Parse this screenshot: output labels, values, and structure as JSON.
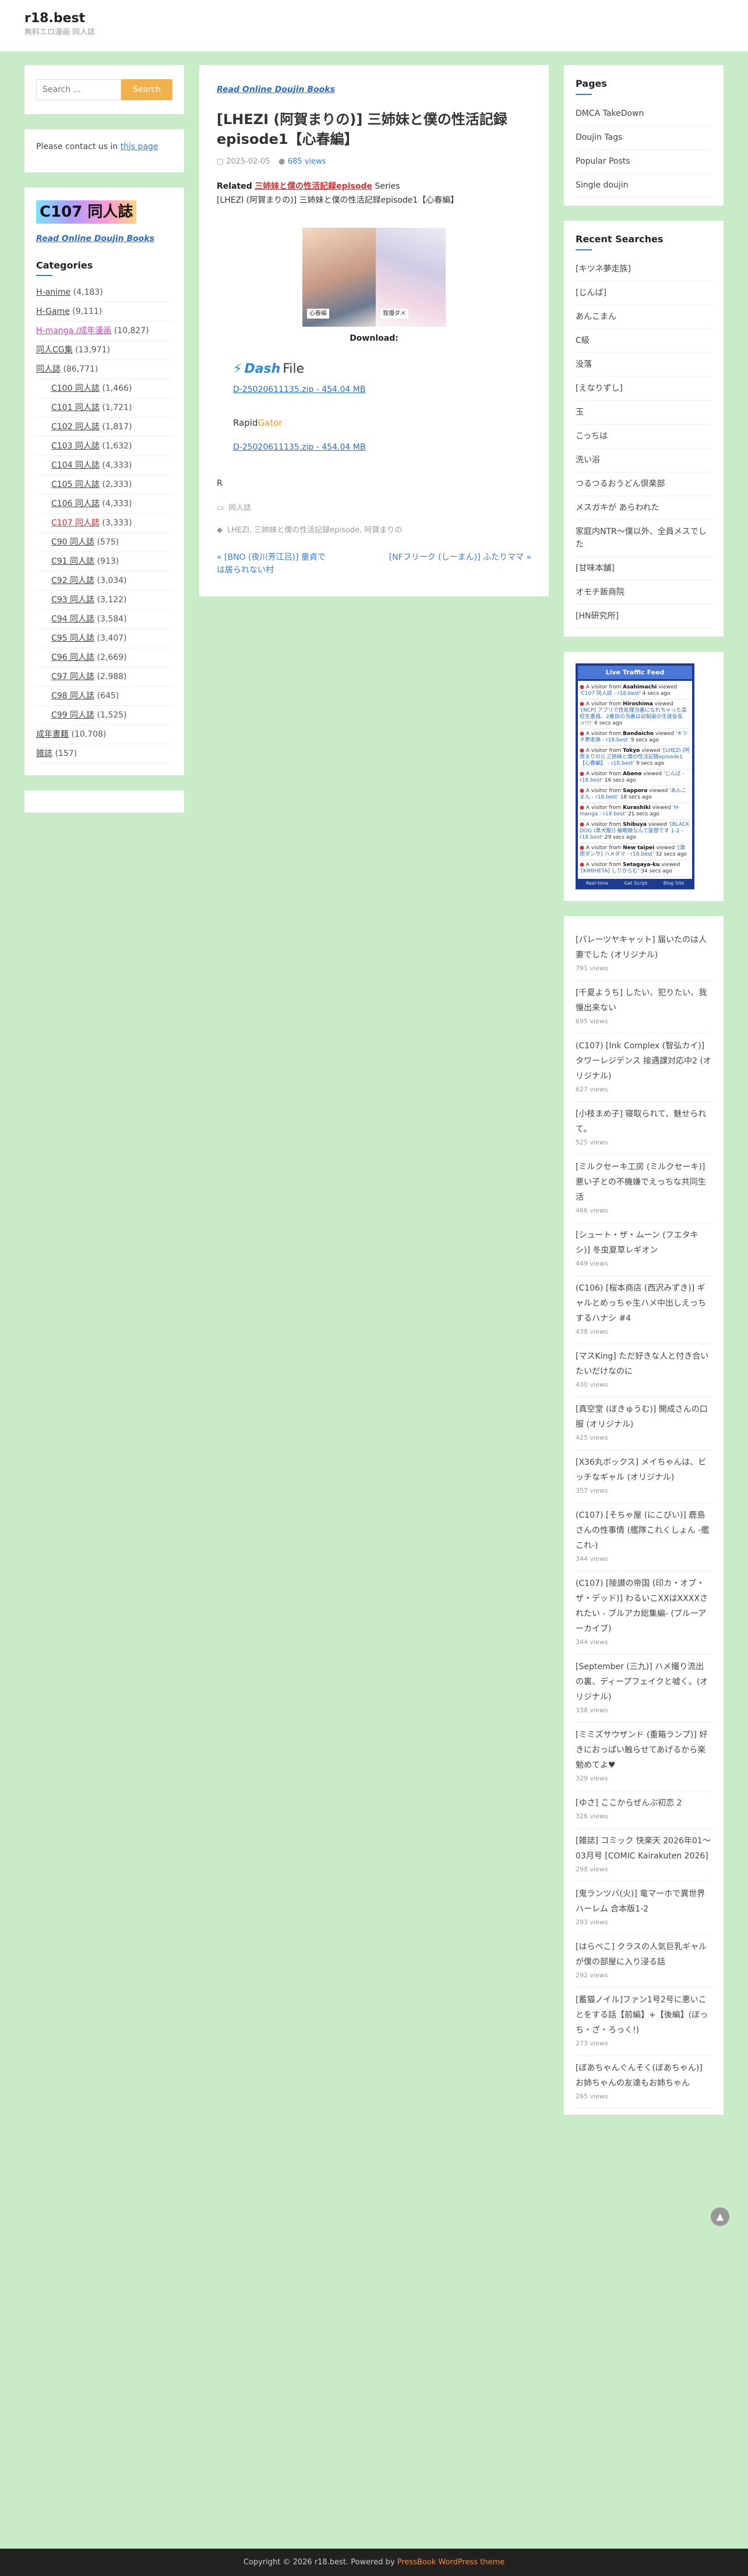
{
  "site": {
    "title": "r18.best",
    "description": "無料エロ漫画 同人誌"
  },
  "search": {
    "placeholder": "Search ...",
    "button": "Search"
  },
  "contact": {
    "prefix": "Please contact us in ",
    "link": "this page"
  },
  "left": {
    "logo_text": "C107 同人誌",
    "read_online": "Read Online Doujin Books",
    "categories_title": "Categories",
    "categories": [
      {
        "label": "H-anime",
        "count": "(4,183)",
        "sub": false,
        "style": ""
      },
      {
        "label": "H-Game",
        "count": "(9,111)",
        "sub": false,
        "style": ""
      },
      {
        "label": "H-manga /成年漫画",
        "count": "(10,827)",
        "sub": false,
        "style": "pink"
      },
      {
        "label": "同人CG集",
        "count": "(13,971)",
        "sub": false,
        "style": ""
      },
      {
        "label": "同人誌",
        "count": "(86,771)",
        "sub": false,
        "style": ""
      },
      {
        "label": "C100 同人誌",
        "count": "(1,466)",
        "sub": true,
        "style": ""
      },
      {
        "label": "C101 同人誌",
        "count": "(1,721)",
        "sub": true,
        "style": ""
      },
      {
        "label": "C102 同人誌",
        "count": "(1,817)",
        "sub": true,
        "style": ""
      },
      {
        "label": "C103 同人誌",
        "count": "(1,632)",
        "sub": true,
        "style": ""
      },
      {
        "label": "C104 同人誌",
        "count": "(4,333)",
        "sub": true,
        "style": ""
      },
      {
        "label": "C105 同人誌",
        "count": "(2,333)",
        "sub": true,
        "style": ""
      },
      {
        "label": "C106 同人誌",
        "count": "(4,333)",
        "sub": true,
        "style": ""
      },
      {
        "label": "C107 同人誌",
        "count": "(3,333)",
        "sub": true,
        "style": "red"
      },
      {
        "label": "C90 同人誌",
        "count": "(575)",
        "sub": true,
        "style": ""
      },
      {
        "label": "C91 同人誌",
        "count": "(913)",
        "sub": true,
        "style": ""
      },
      {
        "label": "C92 同人誌",
        "count": "(3,034)",
        "sub": true,
        "style": ""
      },
      {
        "label": "C93 同人誌",
        "count": "(3,122)",
        "sub": true,
        "style": ""
      },
      {
        "label": "C94 同人誌",
        "count": "(3,584)",
        "sub": true,
        "style": ""
      },
      {
        "label": "C95 同人誌",
        "count": "(3,407)",
        "sub": true,
        "style": ""
      },
      {
        "label": "C96 同人誌",
        "count": "(2,669)",
        "sub": true,
        "style": ""
      },
      {
        "label": "C97 同人誌",
        "count": "(2,988)",
        "sub": true,
        "style": ""
      },
      {
        "label": "C98 同人誌",
        "count": "(645)",
        "sub": true,
        "style": ""
      },
      {
        "label": "C99 同人誌",
        "count": "(1,525)",
        "sub": true,
        "style": ""
      },
      {
        "label": "成年書籍",
        "count": "(10,708)",
        "sub": false,
        "style": ""
      },
      {
        "label": "雑誌",
        "count": "(157)",
        "sub": false,
        "style": ""
      }
    ]
  },
  "post": {
    "top_link": "Read Online Doujin Books",
    "title": "[LHEZI (阿賀まりの)] 三姉妹と僕の性活記録episode1【心春編】",
    "date": "2025-02-05",
    "views": "685 views",
    "related_prefix": "Related",
    "related_series": "三姉妹と僕の性活記録episode",
    "related_suffix": "Series",
    "related_item": "[LHEZI (阿賀まりの)] 三姉妹と僕の性活記録episode1【心春編】",
    "cover_tag_left": "心春編",
    "cover_tag_right": "我慢ダメ",
    "download_label": "Download:",
    "dash_prefix": "Dash",
    "dash_suffix": "File",
    "dash_link": "D-25020611135.zip - 454.04 MB",
    "rapid_prefix": "Rapid",
    "rapid_suffix": "Gator",
    "rapid_link": "D-25020611135.zip - 454.04 MB",
    "letter": "R",
    "category": "同人誌",
    "tags": "LHEZI, 三姉妹と僕の性活記録episode, 阿賀まりの",
    "prev": "« [BNO (夜川芳江吕)] 童貞では居られない村",
    "next": "[NFフリーク (しーまん)] ふたりママ »"
  },
  "pages": {
    "title": "Pages",
    "items": [
      "DMCA TakeDown",
      "Doujin Tags",
      "Popular Posts",
      "Single doujin"
    ]
  },
  "recent": {
    "title": "Recent Searches",
    "items": [
      "[キツネ夢走族]",
      "[じんば]",
      "あんこまん",
      "C級",
      "没落",
      "[えなりずし]",
      "玉",
      "こっちは",
      "洗い浴",
      "つるつるおうどん倶楽部",
      "メスガキが あらわれた",
      "家庭内NTR〜僕以外、全員メスでした",
      "[甘味本舗]",
      "オモチ飯商院",
      "[HN研究所]"
    ]
  },
  "feed": {
    "title": "Live Traffic Feed",
    "items": [
      {
        "loc": "Asahimachi",
        "viewed": "'C107 同人誌 - r18.best'",
        "ago": "4 secs ago"
      },
      {
        "loc": "Hiroshima",
        "viewed": "'[NCP] アブリで性処理当番になれちゃった高校生委員。2番目の当番は幼馴染の生徒会長ッ!!!' ",
        "ago": "6 secs ago"
      },
      {
        "loc": "Bandaicho",
        "viewed": "'キツネ夢走族 - r18.best'",
        "ago": "9 secs ago"
      },
      {
        "loc": "Tokyo",
        "viewed": "'[LHEZI (阿賀まりの)] 三姉妹と僕の性活記録episode1【心春編】 - r18.best'",
        "ago": "9 secs ago"
      },
      {
        "loc": "Abeno",
        "viewed": "'じんば - r18.best'",
        "ago": "16 secs ago"
      },
      {
        "loc": "Sapporo",
        "viewed": "'あんこまん - r18.best'",
        "ago": "18 secs ago"
      },
      {
        "loc": "Kurashiki",
        "viewed": "'H-manga - r18.best'",
        "ago": "21 secs ago"
      },
      {
        "loc": "Shibuya",
        "viewed": "'[BLACK DOG (黒犬獣)] 催眠娘なんて妄想です 1-2 - r18.best'",
        "ago": "29 secs ago"
      },
      {
        "loc": "New taipei",
        "viewed": "'[激昂ダンサ] ハメダマ - r18.best'",
        "ago": "32 secs ago"
      },
      {
        "loc": "Setagaya-ku",
        "viewed": "'[KIMIHETA] しりからむ'",
        "ago": "34 secs ago"
      }
    ],
    "visitor_prefix": "A visitor from",
    "viewed_word": "viewed",
    "footer": [
      "Real-time",
      "Get Script",
      "Blog Site"
    ]
  },
  "popular": [
    {
      "title": "[パレーツヤキャット] 届いたのは人妻でした (オリジナル)",
      "views": "791 views"
    },
    {
      "title": "[千夏ようち] したい、犯りたい、我慢出来ない",
      "views": "695 views"
    },
    {
      "title": "(C107) [Ink Complex (智弘カイ)] タワーレジデンス 接遇課対応中2 (オリジナル)",
      "views": "627 views"
    },
    {
      "title": "[小枝まめ子] 寝取られて、魅せられて。",
      "views": "525 views"
    },
    {
      "title": "[ミルクセーキ工房 (ミルクセーキ)] 悪い子との不機嫌でえっちな共同生活",
      "views": "466 views"
    },
    {
      "title": "[シュート・ザ・ムーン (フエタキシ)] 冬虫夏草レギオン",
      "views": "449 views"
    },
    {
      "title": "(C106) [桜本商店 (西沢みずき)] ギャルとめっちゃ生ハメ中出しえっちするハナシ #4",
      "views": "438 views"
    },
    {
      "title": "[マスKing] ただ好きな人と付き合いたいだけなのに",
      "views": "430 views"
    },
    {
      "title": "[真空堂 (ぼきゅうむ)] 開成さんの口服 (オリジナル)",
      "views": "425 views"
    },
    {
      "title": "[X36丸ボックス] メイちゃんは、ビッチなギャル (オリジナル)",
      "views": "357 views"
    },
    {
      "title": "(C107) [そちゃ屋 (にこびい)] 鹿島さんの性事情 (艦隊これくしょん -艦これ-)",
      "views": "344 views"
    },
    {
      "title": "(C107) [陵讃の帝国 (印カ・オブ・ザ・デッド)] わるいこXXはXXXXされたい - ブルアカ総集編- (ブルーアーカイブ)",
      "views": "344 views"
    },
    {
      "title": "[September (三九)] ハメ撮り流出の裏、ディープフェイクと嘘く。(オリジナル)",
      "views": "338 views"
    },
    {
      "title": "[ミミズサウザンド (重箱ランプ)] 好きにおっぱい触らせてあげるから楽勉めてよ♥",
      "views": "329 views"
    },
    {
      "title": "[ゆさ] ここからぜんぶ初恋 2",
      "views": "326 views"
    },
    {
      "title": "[雑誌] コミック 快楽天 2026年01〜03月号 [COMIC Kairakuten 2026]",
      "views": "298 views"
    },
    {
      "title": "[鬼ランツバ(火)] 竜マーホで異世界ハーレム 合本版1-2",
      "views": "293 views"
    },
    {
      "title": "[はらぺこ] クラスの人気巨乳ギャルが僕の部屋に入り浸る話",
      "views": "292 views"
    },
    {
      "title": "[蓄猫ノイル]ファン1号2号に悪いことをする話【前編】+【後編】(ぼっち・ざ・ろっく!)",
      "views": "273 views"
    },
    {
      "title": "[ぼあちゃんぐんそく(ぼあちゃん)] お姉ちゃんの友達もお姉ちゃん",
      "views": "265 views"
    }
  ],
  "footer": {
    "prefix": "Copyright © 2026 r18.best. Powered by",
    "theme": "PressBook WordPress theme"
  },
  "colors": {
    "background": "#c8ecc8",
    "accent": "#3a7bd5",
    "search_button": "#f3b14e",
    "footer": "#222222"
  }
}
